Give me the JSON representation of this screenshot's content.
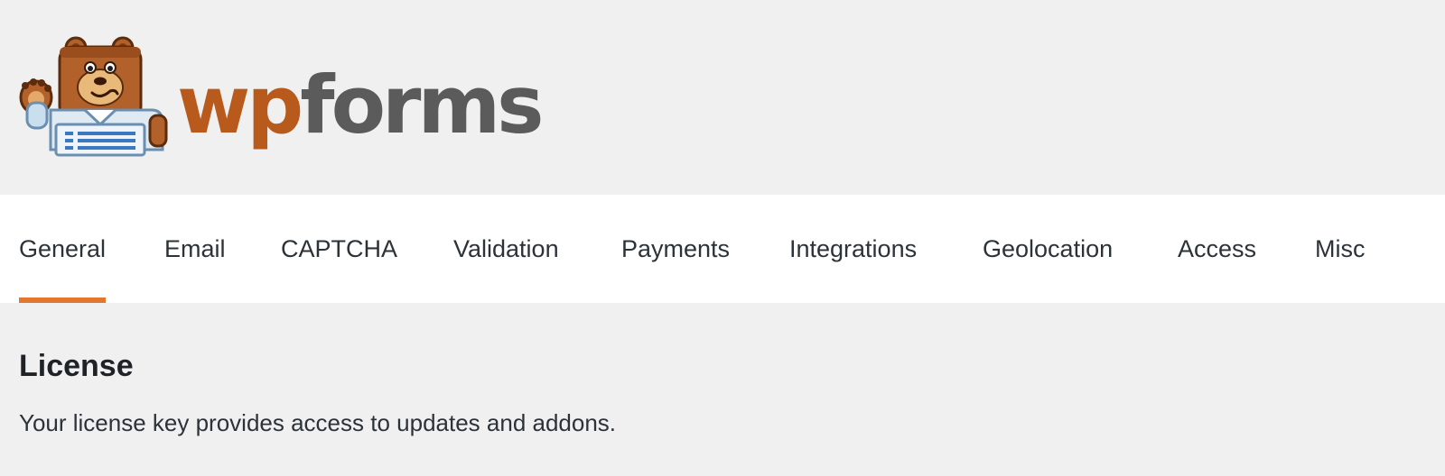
{
  "brand": {
    "logo_wp": "wp",
    "logo_forms": "forms",
    "mascot": "bear-mascot-icon",
    "colors": {
      "wp": "#b85a1b",
      "forms": "#5b5b5b",
      "accent": "#e27730"
    }
  },
  "tabs": [
    {
      "label": "General",
      "active": true
    },
    {
      "label": "Email",
      "active": false
    },
    {
      "label": "CAPTCHA",
      "active": false
    },
    {
      "label": "Validation",
      "active": false
    },
    {
      "label": "Payments",
      "active": false
    },
    {
      "label": "Integrations",
      "active": false
    },
    {
      "label": "Geolocation",
      "active": false
    },
    {
      "label": "Access",
      "active": false
    },
    {
      "label": "Misc",
      "active": false
    }
  ],
  "section": {
    "title": "License",
    "description": "Your license key provides access to updates and addons."
  }
}
